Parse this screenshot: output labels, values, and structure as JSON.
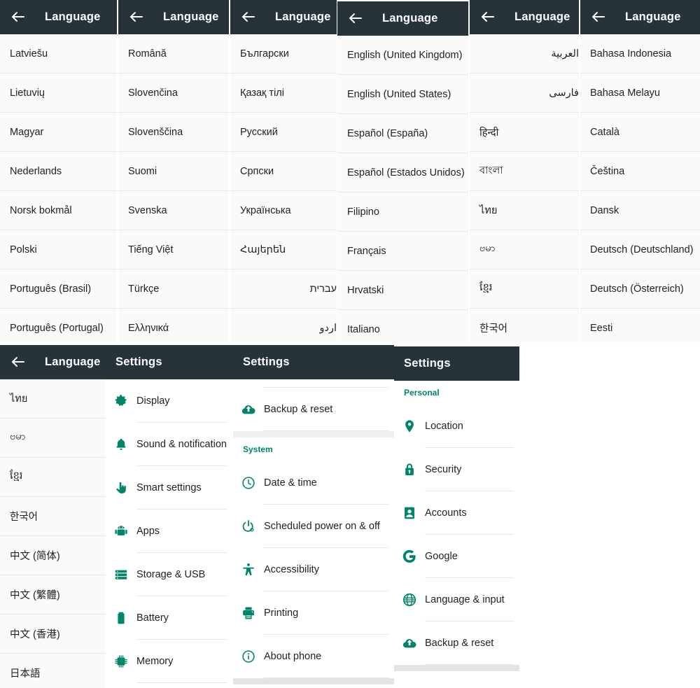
{
  "colors": {
    "appbar_bg": "#27333a",
    "accent": "#00856b",
    "list_bg": "#fafafa",
    "divider": "#e8e8e8",
    "text": "#222222"
  },
  "language_title": "Language",
  "settings_title": "Settings",
  "back_icon": "arrow-left-icon",
  "panels": [
    {
      "id": "lang-col-1",
      "title": "Language",
      "items": [
        "Latviešu",
        "Lietuvių",
        "Magyar",
        "Nederlands",
        "Norsk bokmål",
        "Polski",
        "Português (Brasil)",
        "Português (Portugal)"
      ]
    },
    {
      "id": "lang-col-2",
      "title": "Language",
      "items": [
        "Română",
        "Slovenčina",
        "Slovenščina",
        "Suomi",
        "Svenska",
        "Tiếng Việt",
        "Türkçe",
        "Ελληνικά"
      ]
    },
    {
      "id": "lang-col-3",
      "title": "Language",
      "items": [
        "Български",
        "Қазақ тілі",
        "Русский",
        "Српски",
        "Українська",
        "Հայերեն",
        "עברית",
        "اردو"
      ]
    },
    {
      "id": "lang-col-4",
      "title": "Language",
      "items": [
        "English (United Kingdom)",
        "English (United States)",
        "Español (España)",
        "Español (Estados Unidos)",
        "Filipino",
        "Français",
        "Hrvatski",
        "Italiano"
      ]
    },
    {
      "id": "lang-col-5",
      "title": "Language",
      "items": [
        "العربية",
        "فارسی",
        "हिन्दी",
        "বাংলা",
        "ไทย",
        "ဗမာ",
        "ខ្មែរ",
        "한국어"
      ]
    },
    {
      "id": "lang-col-6",
      "title": "Language",
      "items": [
        "Bahasa Indonesia",
        "Bahasa Melayu",
        "Català",
        "Čeština",
        "Dansk",
        "Deutsch (Deutschland)",
        "Deutsch (Österreich)",
        "Eesti"
      ]
    },
    {
      "id": "lang-col-7",
      "title": "Language",
      "items": [
        "ไทย",
        "ဗမာ",
        "ខ្មែរ",
        "한국어",
        "中文 (简体)",
        "中文 (繁體)",
        "中文 (香港)",
        "日本語"
      ]
    }
  ],
  "settings_panels": [
    {
      "id": "settings-col-1",
      "title": "Settings",
      "rows": [
        {
          "type": "item",
          "icon": "brightness-icon",
          "label": "Display"
        },
        {
          "type": "item",
          "icon": "bell-icon",
          "label": "Sound & notification"
        },
        {
          "type": "item",
          "icon": "hand-pointer-icon",
          "label": "Smart settings"
        },
        {
          "type": "item",
          "icon": "android-icon",
          "label": "Apps"
        },
        {
          "type": "item",
          "icon": "storage-icon",
          "label": "Storage & USB"
        },
        {
          "type": "item",
          "icon": "battery-icon",
          "label": "Battery"
        },
        {
          "type": "item",
          "icon": "memory-chip-icon",
          "label": "Memory"
        }
      ]
    },
    {
      "id": "settings-col-2",
      "title": "Settings",
      "rows": [
        {
          "type": "stub"
        },
        {
          "type": "item",
          "icon": "cloud-upload-icon",
          "label": "Backup & reset"
        },
        {
          "type": "gap"
        },
        {
          "type": "section",
          "label": "System"
        },
        {
          "type": "item",
          "icon": "clock-icon",
          "label": "Date & time"
        },
        {
          "type": "item",
          "icon": "power-icon",
          "label": "Scheduled power on & off"
        },
        {
          "type": "item",
          "icon": "accessibility-icon",
          "label": "Accessibility"
        },
        {
          "type": "item",
          "icon": "printer-icon",
          "label": "Printing"
        },
        {
          "type": "item",
          "icon": "info-icon",
          "label": "About phone"
        }
      ]
    },
    {
      "id": "settings-col-3",
      "title": "Settings",
      "rows": [
        {
          "type": "section",
          "label": "Personal"
        },
        {
          "type": "item",
          "icon": "location-pin-icon",
          "label": "Location"
        },
        {
          "type": "item",
          "icon": "lock-icon",
          "label": "Security"
        },
        {
          "type": "item",
          "icon": "account-icon",
          "label": "Accounts"
        },
        {
          "type": "item",
          "icon": "google-g-icon",
          "label": "Google"
        },
        {
          "type": "item",
          "icon": "globe-icon",
          "label": "Language & input"
        },
        {
          "type": "item",
          "icon": "cloud-upload-icon",
          "label": "Backup & reset"
        }
      ]
    }
  ]
}
